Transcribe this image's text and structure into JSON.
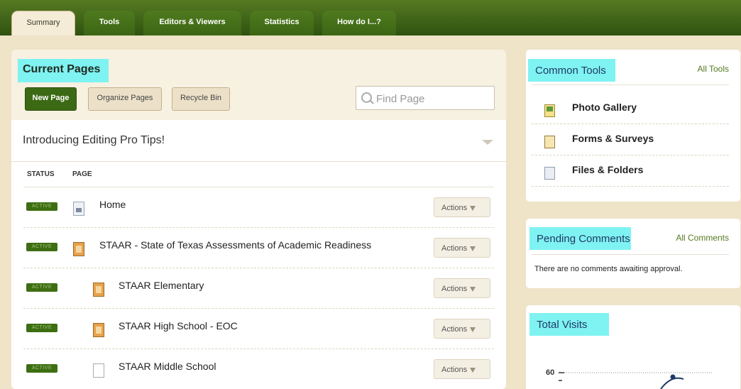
{
  "tabs": [
    {
      "label": "Summary",
      "active": true
    },
    {
      "label": "Tools"
    },
    {
      "label": "Editors & Viewers"
    },
    {
      "label": "Statistics"
    },
    {
      "label": "How do I...?"
    }
  ],
  "current_pages": {
    "title": "Current Pages",
    "new_page": "New Page",
    "organize_pages": "Organize Pages",
    "recycle_bin": "Recycle Bin",
    "find_placeholder": "Find Page",
    "banner": "Introducing Editing Pro Tips!",
    "col_status": "STATUS",
    "col_page": "PAGE",
    "rows": [
      {
        "status": "ACTIVE",
        "title": "Home",
        "icon": "home-page-icon",
        "indent": 0,
        "actions": "Actions"
      },
      {
        "status": "ACTIVE",
        "title": "STAAR - State of Texas Assessments of Academic Readiness",
        "icon": "book-page-icon",
        "indent": 0,
        "actions": "Actions"
      },
      {
        "status": "ACTIVE",
        "title": "STAAR Elementary",
        "icon": "book-page-icon",
        "indent": 1,
        "actions": "Actions"
      },
      {
        "status": "ACTIVE",
        "title": "STAAR High School - EOC",
        "icon": "book-page-icon",
        "indent": 1,
        "actions": "Actions"
      },
      {
        "status": "ACTIVE",
        "title": "STAAR Middle School",
        "icon": "document-page-icon",
        "indent": 1,
        "actions": "Actions"
      }
    ]
  },
  "common_tools": {
    "title": "Common Tools",
    "all_link": "All Tools",
    "items": [
      {
        "label": "Photo Gallery",
        "icon": "photo-gallery-icon"
      },
      {
        "label": "Forms & Surveys",
        "icon": "forms-icon"
      },
      {
        "label": "Files & Folders",
        "icon": "files-icon"
      }
    ]
  },
  "pending_comments": {
    "title": "Pending Comments",
    "all_link": "All Comments",
    "message": "There are no comments awaiting approval."
  },
  "total_visits": {
    "title": "Total Visits",
    "y_tick": "60"
  },
  "colors": {
    "accent_green": "#3c6a14",
    "highlight_cyan": "#7ff2f2",
    "badge_green": "#3e6e12"
  }
}
